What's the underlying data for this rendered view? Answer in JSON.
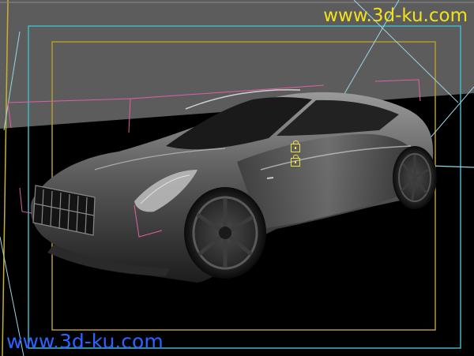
{
  "viewport": {
    "background_color": "#000000",
    "sky_color": "#5c5c5c",
    "frame_outer_color": "#c8b030",
    "safe_frame_color": "#3fb6c8",
    "title_safe_color": "#b59a2c",
    "camera_color": "#e060a0",
    "guide_line_color": "#9ad6e6",
    "car_body_color": "#8a8a8a"
  },
  "watermark": {
    "top_text": "www.3d-ku.com",
    "bottom_text": "www.3d-ku.com",
    "top_color": "#f2e21a",
    "bottom_color": "#2a63ff"
  },
  "icons": {
    "upper_lock": "lock-icon",
    "lower_lock": "lock-icon",
    "lock_color": "#f0e040"
  }
}
